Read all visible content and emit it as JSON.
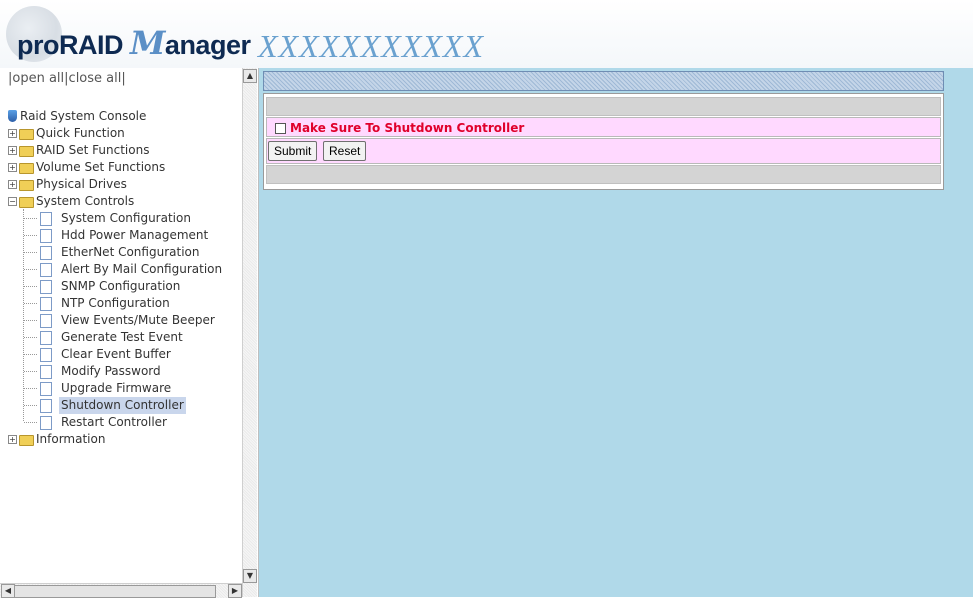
{
  "header": {
    "logo_pre": "proRAID ",
    "logo_m": "M",
    "logo_post": "anager",
    "brand": "XXXXXXXXXXX"
  },
  "sidebar": {
    "open_all": "open all",
    "close_all": "close all",
    "root": "Raid System Console",
    "folders": [
      "Quick Function",
      "RAID Set Functions",
      "Volume Set Functions",
      "Physical Drives",
      "System Controls",
      "Information"
    ],
    "system_controls_items": [
      "System Configuration",
      "Hdd Power Management",
      "EtherNet Configuration",
      "Alert By Mail Configuration",
      "SNMP Configuration",
      "NTP Configuration",
      "View Events/Mute Beeper",
      "Generate Test Event",
      "Clear Event Buffer",
      "Modify Password",
      "Upgrade Firmware",
      "Shutdown Controller",
      "Restart Controller"
    ],
    "selected": "Shutdown Controller"
  },
  "main": {
    "checkbox_label": "Make Sure To Shutdown Controller",
    "submit_label": "Submit",
    "reset_label": "Reset"
  },
  "colors": {
    "content_bg": "#b0d9e9",
    "pink_row": "#ffd9ff",
    "warning_text": "#e0002b",
    "brand_blue": "#6aa1cf"
  }
}
